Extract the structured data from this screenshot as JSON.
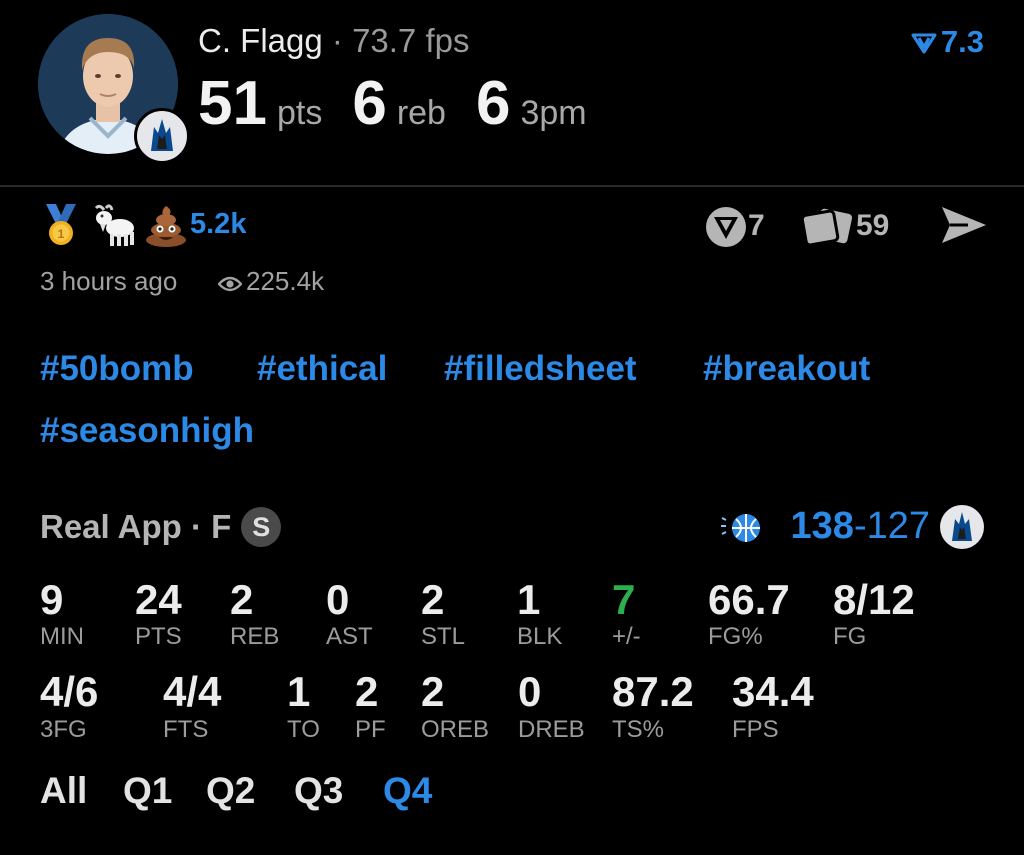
{
  "player": {
    "name": "C. Flagg",
    "separator": "·",
    "fps_text": "73.7 fps",
    "rating": "7.3",
    "big_stats": [
      {
        "value": "51",
        "unit": "pts"
      },
      {
        "value": "6",
        "unit": "reb"
      },
      {
        "value": "6",
        "unit": "3pm"
      }
    ]
  },
  "reactions": {
    "emojis": [
      "gold-medal-icon",
      "goat-icon",
      "poop-icon"
    ],
    "count": "5.2k",
    "tip_count": "7",
    "card_count": "59"
  },
  "meta": {
    "time": "3 hours ago",
    "views": "225.4k"
  },
  "tags": [
    "#50bomb",
    "#ethical",
    "#filledsheet",
    "#breakout",
    "#seasonhigh"
  ],
  "game": {
    "title": "Real App · F",
    "badge": "S",
    "score_home": "138",
    "score_sep": "-",
    "score_away": "127"
  },
  "stats_row1": [
    {
      "value": "9",
      "label": "MIN"
    },
    {
      "value": "24",
      "label": "PTS"
    },
    {
      "value": "2",
      "label": "REB"
    },
    {
      "value": "0",
      "label": "AST"
    },
    {
      "value": "2",
      "label": "STL"
    },
    {
      "value": "1",
      "label": "BLK"
    },
    {
      "value": "7",
      "label": "+/-"
    },
    {
      "value": "66.7",
      "label": "FG%"
    },
    {
      "value": "8/12",
      "label": "FG"
    }
  ],
  "stats_row2": [
    {
      "value": "4/6",
      "label": "3FG"
    },
    {
      "value": "4/4",
      "label": "FTS"
    },
    {
      "value": "1",
      "label": "TO"
    },
    {
      "value": "2",
      "label": "PF"
    },
    {
      "value": "2",
      "label": "OREB"
    },
    {
      "value": "0",
      "label": "DREB"
    },
    {
      "value": "87.2",
      "label": "TS%"
    },
    {
      "value": "34.4",
      "label": "FPS"
    }
  ],
  "quarters": [
    "All",
    "Q1",
    "Q2",
    "Q3",
    "Q4"
  ],
  "colors": {
    "accent": "#2c8ae6",
    "positive": "#2cb04f"
  }
}
